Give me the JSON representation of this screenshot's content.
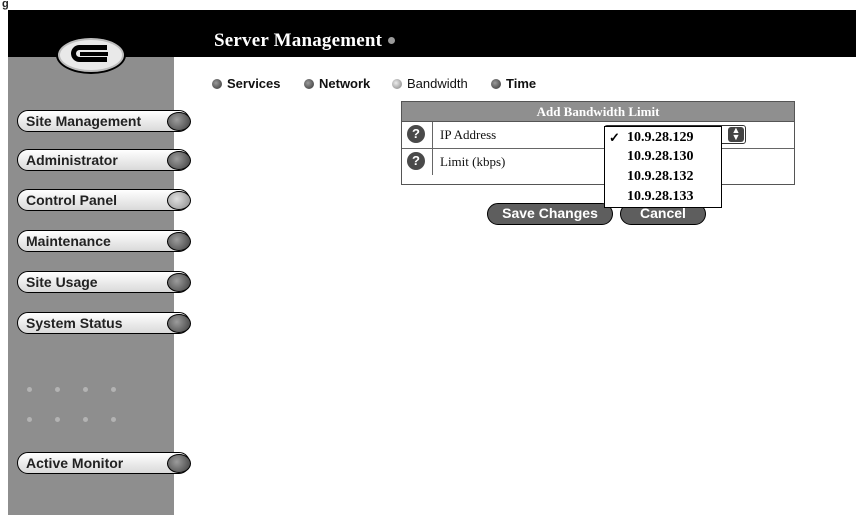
{
  "figure_tag": "g",
  "header": {
    "title": "Server Management"
  },
  "sidebar": {
    "logo_icon": "cobalt-c-logo",
    "items": [
      {
        "label": "Site Management",
        "knob": "dark"
      },
      {
        "label": "Administrator",
        "knob": "dark"
      },
      {
        "label": "Control Panel",
        "knob": "light"
      },
      {
        "label": "Maintenance",
        "knob": "dark"
      },
      {
        "label": "Site Usage",
        "knob": "dark"
      },
      {
        "label": "System Status",
        "knob": "dark"
      }
    ],
    "active_monitor_label": "Active Monitor"
  },
  "subnav": {
    "items": [
      {
        "label": "Services"
      },
      {
        "label": "Network"
      },
      {
        "label": "Bandwidth",
        "selected": true
      },
      {
        "label": "Time"
      }
    ]
  },
  "form": {
    "title": "Add Bandwidth Limit",
    "ip_label": "IP Address",
    "limit_label": "Limit (kbps)",
    "help_glyph": "?"
  },
  "ip_dropdown": {
    "selected": "10.9.28.129",
    "options": [
      "10.9.28.129",
      "10.9.28.130",
      "10.9.28.132",
      "10.9.28.133"
    ],
    "check_glyph": "✓"
  },
  "buttons": {
    "save_label": "Save Changes",
    "cancel_label": "Cancel"
  },
  "colors": {
    "header_bg": "#000000",
    "sidebar_bg": "#8e8e8e",
    "form_header_bg": "#8f8f8f",
    "button_bg": "#5e5e5e"
  }
}
